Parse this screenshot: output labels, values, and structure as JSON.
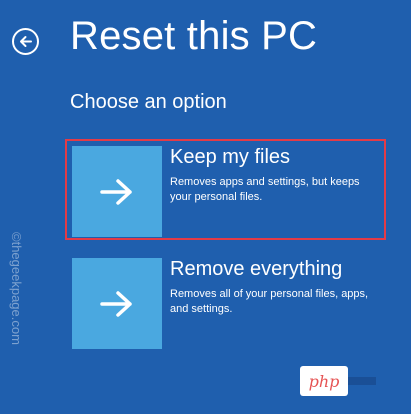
{
  "header": {
    "title": "Reset this PC",
    "back_icon": "back-arrow-icon"
  },
  "subtitle": "Choose an option",
  "options": [
    {
      "title": "Keep my files",
      "description": "Removes apps and settings, but keeps your personal files.",
      "icon": "right-arrow-icon"
    },
    {
      "title": "Remove everything",
      "description": "Removes all of your personal files, apps, and settings.",
      "icon": "right-arrow-icon"
    }
  ],
  "watermark": "©thegeekpage.com",
  "php_badge": "php",
  "colors": {
    "background": "#1f5fae",
    "tile": "#4aa8e0",
    "highlight": "#e33b47"
  }
}
